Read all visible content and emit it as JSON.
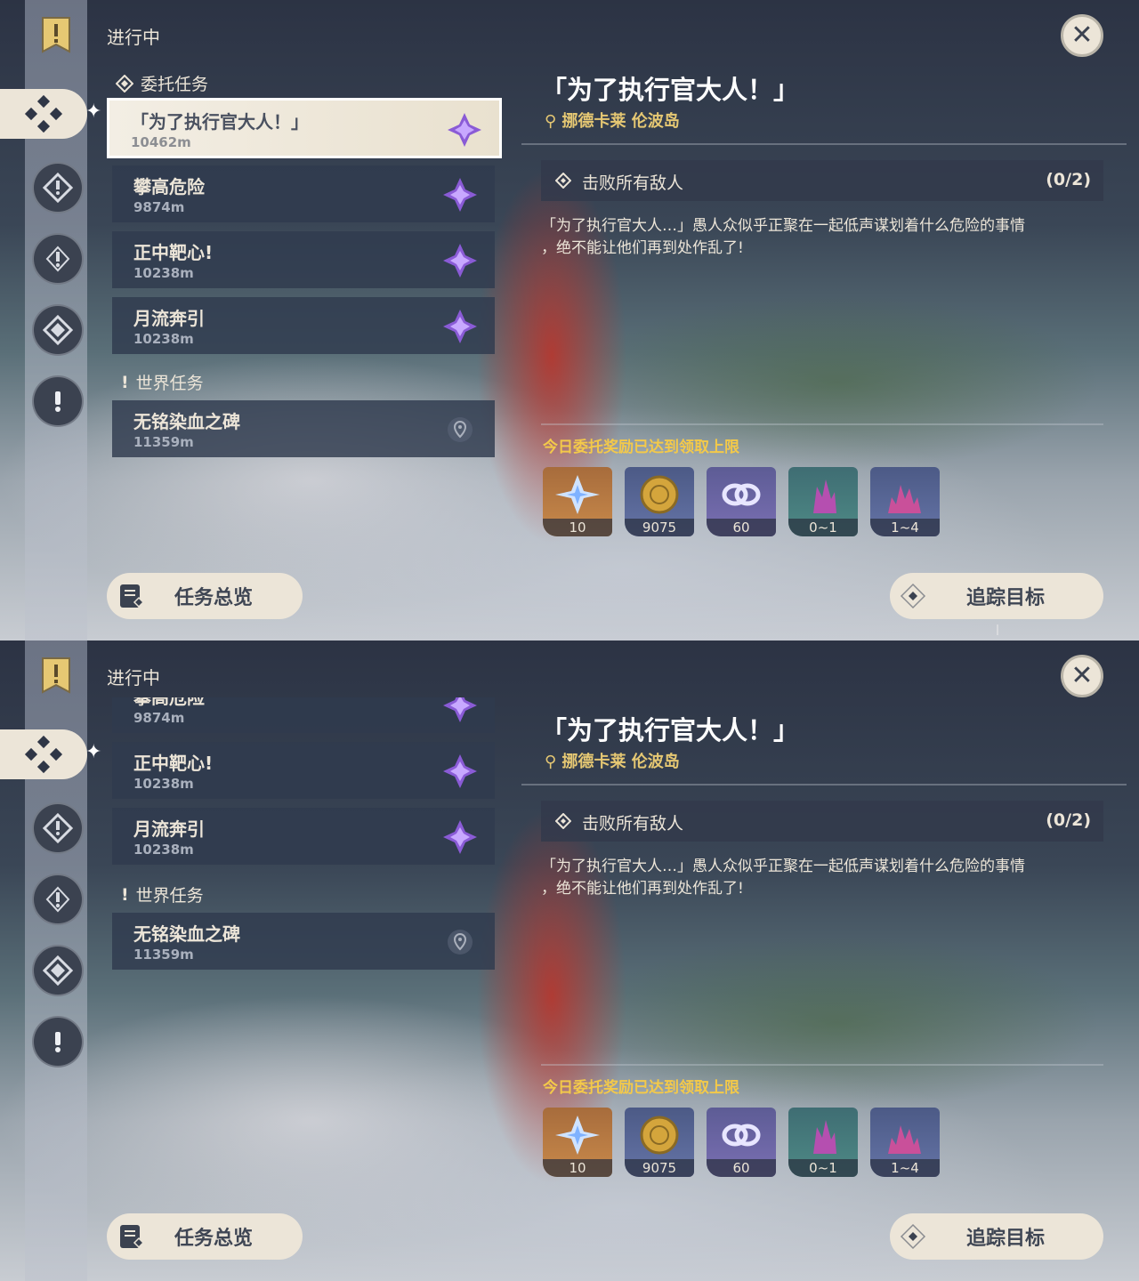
{
  "header": {
    "title": "进行中"
  },
  "sections": {
    "commission": "委托任务",
    "world": "世界任务"
  },
  "quests": [
    {
      "name": "「为了执行官大人！」",
      "distance": "10462m"
    },
    {
      "name": "攀高危险",
      "distance": "9874m"
    },
    {
      "name": "正中靶心!",
      "distance": "10238m"
    },
    {
      "name": "月流奔引",
      "distance": "10238m"
    }
  ],
  "world_quests": [
    {
      "name": "无铭染血之碑",
      "distance": "11359m"
    }
  ],
  "detail": {
    "title": "「为了执行官大人！」",
    "location": "挪德卡莱 伦波岛",
    "objective": "击败所有敌人",
    "objective_count": "(0/2)",
    "description_line1": "「为了执行官大人…」愚人众似乎正聚在一起低声谋划着什么危险的事情",
    "description_line2": "，绝不能让他们再到处作乱了!",
    "reward_note": "今日委托奖励已达到领取上限"
  },
  "rewards": [
    {
      "icon": "primogem-icon",
      "amount": "10"
    },
    {
      "icon": "mora-coin-icon",
      "amount": "9075"
    },
    {
      "icon": "companionship-exp-icon",
      "amount": "60"
    },
    {
      "icon": "crystal-small-icon",
      "amount": "0~1"
    },
    {
      "icon": "crystal-cluster-icon",
      "amount": "1~4"
    }
  ],
  "buttons": {
    "overview": "任务总览",
    "track": "追踪目标"
  },
  "colors": {
    "accent_gold": "#f3c94a",
    "panel_cream": "#ece5d8",
    "location_gold": "#e6c873"
  }
}
